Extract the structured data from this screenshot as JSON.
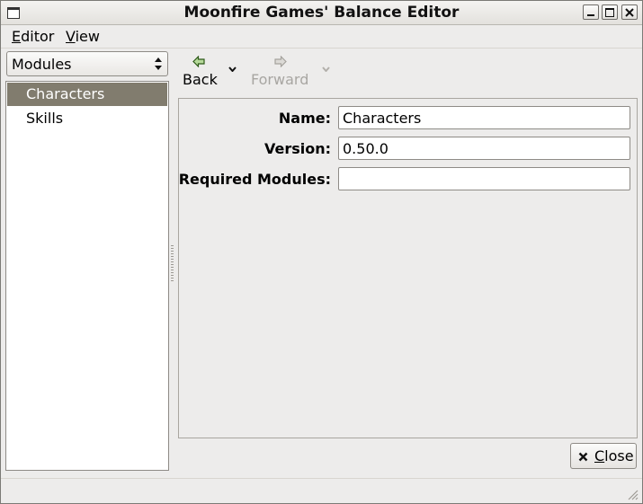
{
  "window": {
    "title": "Moonfire Games' Balance Editor"
  },
  "menubar": {
    "editor": {
      "mnemonic": "E",
      "rest": "ditor"
    },
    "view": {
      "mnemonic": "V",
      "rest": "iew"
    }
  },
  "sidebar": {
    "combo_value": "Modules",
    "items": [
      {
        "label": "Characters",
        "selected": true
      },
      {
        "label": "Skills",
        "selected": false
      }
    ]
  },
  "toolbar": {
    "back_label": "Back",
    "forward_label": "Forward",
    "back_icon": "arrow-left-icon",
    "forward_icon": "arrow-right-icon"
  },
  "form": {
    "name_label": "Name:",
    "name_value": "Characters",
    "version_label": "Version:",
    "version_value": "0.50.0",
    "required_label": "Required Modules:",
    "required_value": ""
  },
  "footer": {
    "close_label": "Close"
  },
  "colors": {
    "selection": "#817c6e",
    "background": "#edeceb",
    "back_arrow": "#3f7a23"
  }
}
